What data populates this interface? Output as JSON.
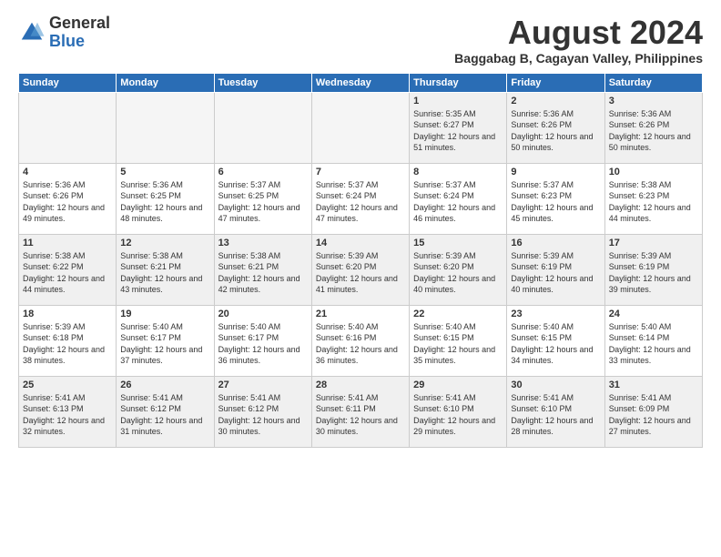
{
  "header": {
    "logo_general": "General",
    "logo_blue": "Blue",
    "month_title": "August 2024",
    "subtitle": "Baggabag B, Cagayan Valley, Philippines"
  },
  "days_of_week": [
    "Sunday",
    "Monday",
    "Tuesday",
    "Wednesday",
    "Thursday",
    "Friday",
    "Saturday"
  ],
  "weeks": [
    {
      "days": [
        {
          "num": "",
          "empty": true
        },
        {
          "num": "",
          "empty": true
        },
        {
          "num": "",
          "empty": true
        },
        {
          "num": "",
          "empty": true
        },
        {
          "num": "1",
          "sunrise": "5:35 AM",
          "sunset": "6:27 PM",
          "daylight": "12 hours and 51 minutes."
        },
        {
          "num": "2",
          "sunrise": "5:36 AM",
          "sunset": "6:26 PM",
          "daylight": "12 hours and 50 minutes."
        },
        {
          "num": "3",
          "sunrise": "5:36 AM",
          "sunset": "6:26 PM",
          "daylight": "12 hours and 50 minutes."
        }
      ]
    },
    {
      "days": [
        {
          "num": "4",
          "sunrise": "5:36 AM",
          "sunset": "6:26 PM",
          "daylight": "12 hours and 49 minutes."
        },
        {
          "num": "5",
          "sunrise": "5:36 AM",
          "sunset": "6:25 PM",
          "daylight": "12 hours and 48 minutes."
        },
        {
          "num": "6",
          "sunrise": "5:37 AM",
          "sunset": "6:25 PM",
          "daylight": "12 hours and 47 minutes."
        },
        {
          "num": "7",
          "sunrise": "5:37 AM",
          "sunset": "6:24 PM",
          "daylight": "12 hours and 47 minutes."
        },
        {
          "num": "8",
          "sunrise": "5:37 AM",
          "sunset": "6:24 PM",
          "daylight": "12 hours and 46 minutes."
        },
        {
          "num": "9",
          "sunrise": "5:37 AM",
          "sunset": "6:23 PM",
          "daylight": "12 hours and 45 minutes."
        },
        {
          "num": "10",
          "sunrise": "5:38 AM",
          "sunset": "6:23 PM",
          "daylight": "12 hours and 44 minutes."
        }
      ]
    },
    {
      "days": [
        {
          "num": "11",
          "sunrise": "5:38 AM",
          "sunset": "6:22 PM",
          "daylight": "12 hours and 44 minutes."
        },
        {
          "num": "12",
          "sunrise": "5:38 AM",
          "sunset": "6:21 PM",
          "daylight": "12 hours and 43 minutes."
        },
        {
          "num": "13",
          "sunrise": "5:38 AM",
          "sunset": "6:21 PM",
          "daylight": "12 hours and 42 minutes."
        },
        {
          "num": "14",
          "sunrise": "5:39 AM",
          "sunset": "6:20 PM",
          "daylight": "12 hours and 41 minutes."
        },
        {
          "num": "15",
          "sunrise": "5:39 AM",
          "sunset": "6:20 PM",
          "daylight": "12 hours and 40 minutes."
        },
        {
          "num": "16",
          "sunrise": "5:39 AM",
          "sunset": "6:19 PM",
          "daylight": "12 hours and 40 minutes."
        },
        {
          "num": "17",
          "sunrise": "5:39 AM",
          "sunset": "6:19 PM",
          "daylight": "12 hours and 39 minutes."
        }
      ]
    },
    {
      "days": [
        {
          "num": "18",
          "sunrise": "5:39 AM",
          "sunset": "6:18 PM",
          "daylight": "12 hours and 38 minutes."
        },
        {
          "num": "19",
          "sunrise": "5:40 AM",
          "sunset": "6:17 PM",
          "daylight": "12 hours and 37 minutes."
        },
        {
          "num": "20",
          "sunrise": "5:40 AM",
          "sunset": "6:17 PM",
          "daylight": "12 hours and 36 minutes."
        },
        {
          "num": "21",
          "sunrise": "5:40 AM",
          "sunset": "6:16 PM",
          "daylight": "12 hours and 36 minutes."
        },
        {
          "num": "22",
          "sunrise": "5:40 AM",
          "sunset": "6:15 PM",
          "daylight": "12 hours and 35 minutes."
        },
        {
          "num": "23",
          "sunrise": "5:40 AM",
          "sunset": "6:15 PM",
          "daylight": "12 hours and 34 minutes."
        },
        {
          "num": "24",
          "sunrise": "5:40 AM",
          "sunset": "6:14 PM",
          "daylight": "12 hours and 33 minutes."
        }
      ]
    },
    {
      "days": [
        {
          "num": "25",
          "sunrise": "5:41 AM",
          "sunset": "6:13 PM",
          "daylight": "12 hours and 32 minutes."
        },
        {
          "num": "26",
          "sunrise": "5:41 AM",
          "sunset": "6:12 PM",
          "daylight": "12 hours and 31 minutes."
        },
        {
          "num": "27",
          "sunrise": "5:41 AM",
          "sunset": "6:12 PM",
          "daylight": "12 hours and 30 minutes."
        },
        {
          "num": "28",
          "sunrise": "5:41 AM",
          "sunset": "6:11 PM",
          "daylight": "12 hours and 30 minutes."
        },
        {
          "num": "29",
          "sunrise": "5:41 AM",
          "sunset": "6:10 PM",
          "daylight": "12 hours and 29 minutes."
        },
        {
          "num": "30",
          "sunrise": "5:41 AM",
          "sunset": "6:10 PM",
          "daylight": "12 hours and 28 minutes."
        },
        {
          "num": "31",
          "sunrise": "5:41 AM",
          "sunset": "6:09 PM",
          "daylight": "12 hours and 27 minutes."
        }
      ]
    }
  ]
}
